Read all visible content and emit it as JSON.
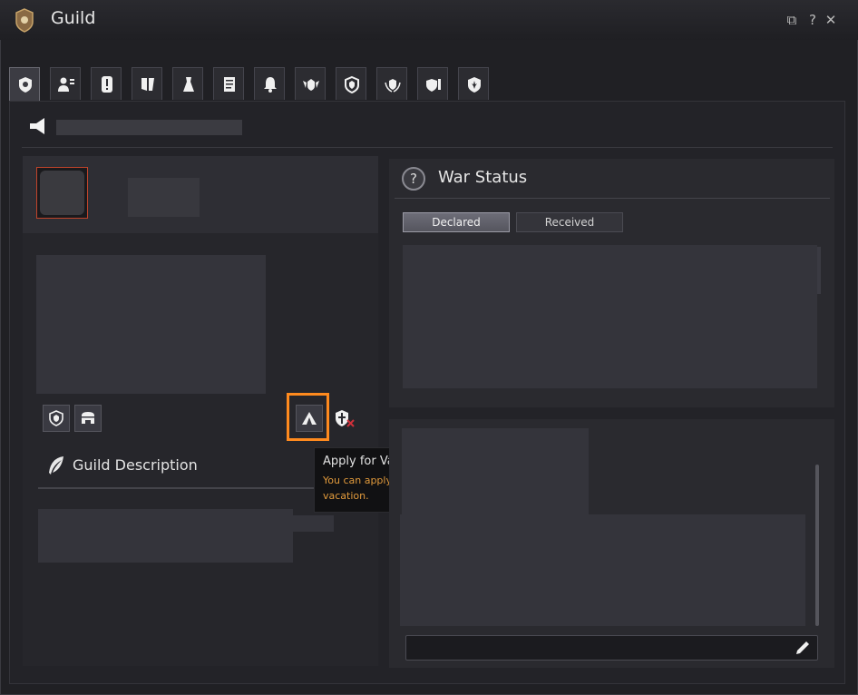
{
  "window": {
    "title": "Guild",
    "controls": [
      "restore-icon",
      "help-icon",
      "close-icon"
    ],
    "control_glyphs": {
      "restore": "⧉",
      "help": "?",
      "close": "✕"
    }
  },
  "tabs": [
    {
      "icon": "guild-crest-icon",
      "active": true
    },
    {
      "icon": "member-list-icon",
      "active": false
    },
    {
      "icon": "alert-icon",
      "active": false
    },
    {
      "icon": "quest-scroll-icon",
      "active": false
    },
    {
      "icon": "costume-icon",
      "active": false
    },
    {
      "icon": "document-icon",
      "active": false
    },
    {
      "icon": "bell-icon",
      "active": false
    },
    {
      "icon": "alliance-icon",
      "active": false
    },
    {
      "icon": "shield-icon",
      "active": false
    },
    {
      "icon": "laurel-shield-icon",
      "active": false
    },
    {
      "icon": "shield-list-icon",
      "active": false
    },
    {
      "icon": "fleur-shield-icon",
      "active": false
    }
  ],
  "left": {
    "desc_title": "Guild Description"
  },
  "tooltip": {
    "title": "Apply for Vacation",
    "body": "You can apply for vacation."
  },
  "war": {
    "help_glyph": "?",
    "title": "War Status",
    "tabs": {
      "declared": "Declared",
      "received": "Received"
    }
  },
  "colors": {
    "highlight": "#ff8a1e",
    "tooltip_body": "#e19a3c",
    "guild_mark_border": "#c0442a"
  }
}
